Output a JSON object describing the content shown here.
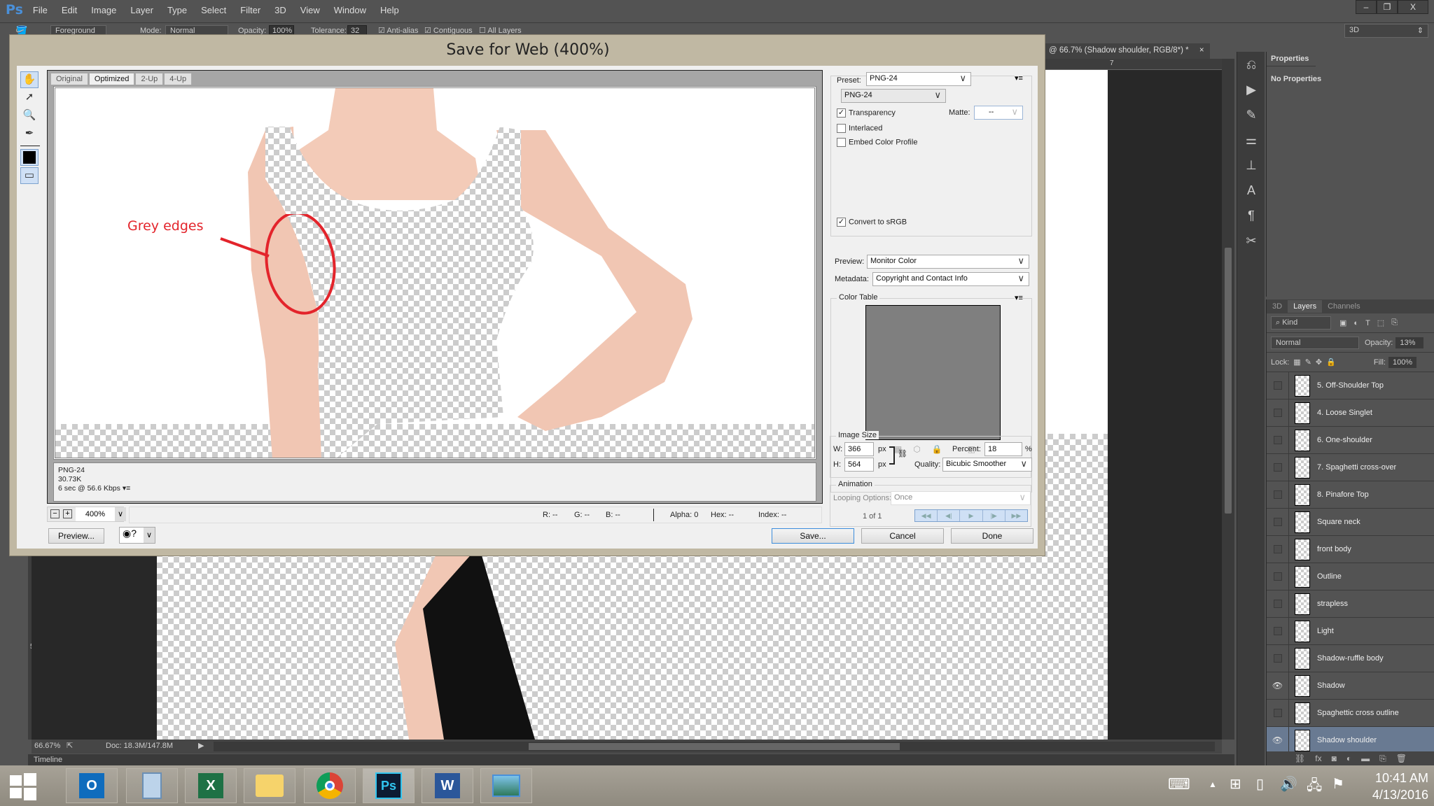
{
  "app": {
    "logo": "Ps",
    "menu": [
      "File",
      "Edit",
      "Image",
      "Layer",
      "Type",
      "Select",
      "Filter",
      "3D",
      "View",
      "Window",
      "Help"
    ],
    "window_controls": {
      "minimize": "–",
      "restore": "❐",
      "close": "X"
    }
  },
  "options_bar": {
    "source_value": "Foreground",
    "mode_label": "Mode:",
    "mode_value": "Normal",
    "opacity_label": "Opacity:",
    "opacity_value": "100%",
    "tolerance_label": "Tolerance:",
    "tolerance_value": "32",
    "antialias_label": "Anti-alias",
    "antialias_checked": true,
    "contiguous_label": "Contiguous",
    "contiguous_checked": true,
    "all_layers_label": "All Layers",
    "all_layers_checked": false,
    "workspace_value": "3D"
  },
  "document": {
    "tab_title": "@ 66.7% (Shadow shoulder, RGB/8*) *",
    "tab_close": "×",
    "ruler_h_label": "7",
    "ruler_v_label": "5",
    "zoom": "66.67%",
    "doc_info": "Doc: 18.3M/147.8M",
    "timeline_label": "Timeline"
  },
  "properties_panel": {
    "tab": "Properties",
    "content": "No Properties"
  },
  "layers_panel": {
    "tabs": [
      "3D",
      "Layers",
      "Channels"
    ],
    "active_tab": "Layers",
    "filter_kind": "Kind",
    "blend_mode": "Normal",
    "opacity_label": "Opacity:",
    "opacity_value": "13%",
    "lock_label": "Lock:",
    "fill_label": "Fill:",
    "fill_value": "100%",
    "layers": [
      {
        "name": "5. Off-Shoulder Top",
        "visible": false,
        "selected": false
      },
      {
        "name": "4. Loose Singlet",
        "visible": false,
        "selected": false
      },
      {
        "name": "6. One-shoulder",
        "visible": false,
        "selected": false
      },
      {
        "name": "7. Spaghetti cross-over",
        "visible": false,
        "selected": false
      },
      {
        "name": "8. Pinafore Top",
        "visible": false,
        "selected": false
      },
      {
        "name": "Square neck",
        "visible": false,
        "selected": false
      },
      {
        "name": "front body",
        "visible": false,
        "selected": false
      },
      {
        "name": "Outline",
        "visible": false,
        "selected": false
      },
      {
        "name": "strapless",
        "visible": false,
        "selected": false
      },
      {
        "name": "Light",
        "visible": false,
        "selected": false
      },
      {
        "name": "Shadow-ruffle body",
        "visible": false,
        "selected": false
      },
      {
        "name": "Shadow",
        "visible": true,
        "selected": false
      },
      {
        "name": "Spaghettic cross outline",
        "visible": false,
        "selected": false
      },
      {
        "name": "Shadow shoulder",
        "visible": true,
        "selected": true
      }
    ],
    "footer_icons": [
      "link-icon",
      "fx-icon",
      "mask-icon",
      "adjustment-icon",
      "folder-icon",
      "new-layer-icon",
      "trash-icon"
    ]
  },
  "dialog": {
    "title": "Save for Web (400%)",
    "view_tabs": [
      "Original",
      "Optimized",
      "2-Up",
      "4-Up"
    ],
    "active_view_tab": "Optimized",
    "annotation": {
      "text": "Grey edges",
      "color": "#e3242b"
    },
    "preview_info": {
      "format": "PNG-24",
      "size": "30.73K",
      "download_time": "6 sec @ 56.6 Kbps"
    },
    "zoom_value": "400%",
    "readout": {
      "r": "R: --",
      "g": "G: --",
      "b": "B: --",
      "alpha": "Alpha: 0",
      "hex": "Hex: --",
      "index": "Index: --"
    },
    "buttons": {
      "preview": "Preview...",
      "save": "Save...",
      "cancel": "Cancel",
      "done": "Done"
    },
    "settings": {
      "preset_label": "Preset:",
      "preset_value": "PNG-24",
      "format_value": "PNG-24",
      "transparency_label": "Transparency",
      "transparency_checked": true,
      "matte_label": "Matte:",
      "matte_value": "--",
      "interlaced_label": "Interlaced",
      "interlaced_checked": false,
      "embed_profile_label": "Embed Color Profile",
      "embed_profile_checked": false,
      "convert_srgb_label": "Convert to sRGB",
      "convert_srgb_checked": true,
      "preview_label": "Preview:",
      "preview_value": "Monitor Color",
      "metadata_label": "Metadata:",
      "metadata_value": "Copyright and Contact Info"
    },
    "color_table": {
      "title": "Color Table",
      "swatch_color": "#7f7f7f"
    },
    "image_size": {
      "title": "Image Size",
      "w_label": "W:",
      "w_value": "366",
      "h_label": "H:",
      "h_value": "564",
      "unit": "px",
      "percent_label": "Percent:",
      "percent_value": "18",
      "percent_unit": "%",
      "quality_label": "Quality:",
      "quality_value": "Bicubic Smoother"
    },
    "animation": {
      "title": "Animation",
      "looping_label": "Looping Options:",
      "looping_value": "Once",
      "frame_counter": "1 of 1"
    }
  },
  "taskbar": {
    "apps": [
      "Outlook",
      "Calculator",
      "Excel",
      "File Explorer",
      "Chrome",
      "Photoshop",
      "Word",
      "Photos"
    ],
    "active_app": "Photoshop",
    "time": "10:41 AM",
    "date": "4/13/2016"
  }
}
